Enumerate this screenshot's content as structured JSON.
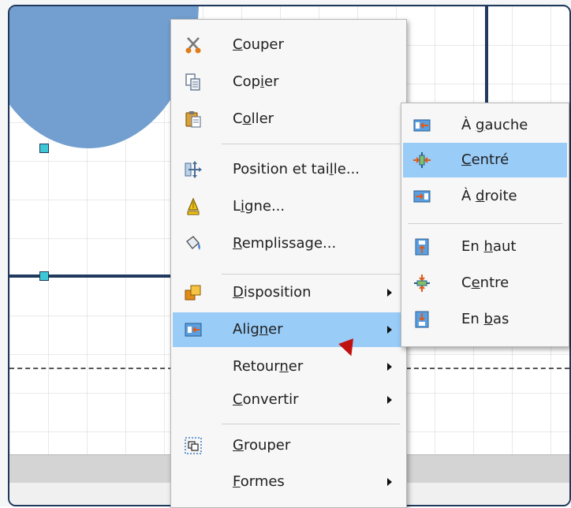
{
  "context_menu": {
    "items": [
      {
        "pre": "",
        "ul": "C",
        "post": "ouper",
        "icon": "scissors-icon"
      },
      {
        "pre": "Cop",
        "ul": "i",
        "post": "er",
        "icon": "copy-icon"
      },
      {
        "pre": "C",
        "ul": "o",
        "post": "ller",
        "icon": "paste-icon"
      },
      {
        "pre": "Position et tai",
        "ul": "l",
        "post": "le...",
        "icon": "position-size-icon"
      },
      {
        "pre": "L",
        "ul": "i",
        "post": "gne...",
        "icon": "line-pen-icon"
      },
      {
        "pre": "",
        "ul": "R",
        "post": "emplissage...",
        "icon": "fill-bucket-icon"
      },
      {
        "pre": "",
        "ul": "D",
        "post": "isposition",
        "icon": "arrange-icon"
      },
      {
        "pre": "Alig",
        "ul": "n",
        "post": "er",
        "icon": "align-icon"
      },
      {
        "pre": "Retour",
        "ul": "n",
        "post": "er",
        "icon": "flip-icon"
      },
      {
        "pre": "",
        "ul": "C",
        "post": "onvertir",
        "icon": "convert-icon"
      },
      {
        "pre": "",
        "ul": "G",
        "post": "rouper",
        "icon": "group-icon"
      },
      {
        "pre": "",
        "ul": "F",
        "post": "ormes",
        "icon": "shapes-icon"
      }
    ]
  },
  "submenu": {
    "items": [
      {
        "pre": "À ",
        "ul": "g",
        "post": "auche",
        "icon": "align-left-icon"
      },
      {
        "pre": "",
        "ul": "C",
        "post": "entré",
        "icon": "align-center-icon"
      },
      {
        "pre": "À ",
        "ul": "d",
        "post": "roite",
        "icon": "align-right-icon"
      },
      {
        "pre": "En ",
        "ul": "h",
        "post": "aut",
        "icon": "align-top-icon"
      },
      {
        "pre": "C",
        "ul": "e",
        "post": "ntre",
        "icon": "align-middle-icon"
      },
      {
        "pre": "En ",
        "ul": "b",
        "post": "as",
        "icon": "align-bottom-icon"
      }
    ]
  },
  "colors": {
    "hover": "#99ccf7",
    "shape_fill": "#729fcf",
    "frame": "#1f3a5c",
    "handle": "#3ec8d6"
  }
}
